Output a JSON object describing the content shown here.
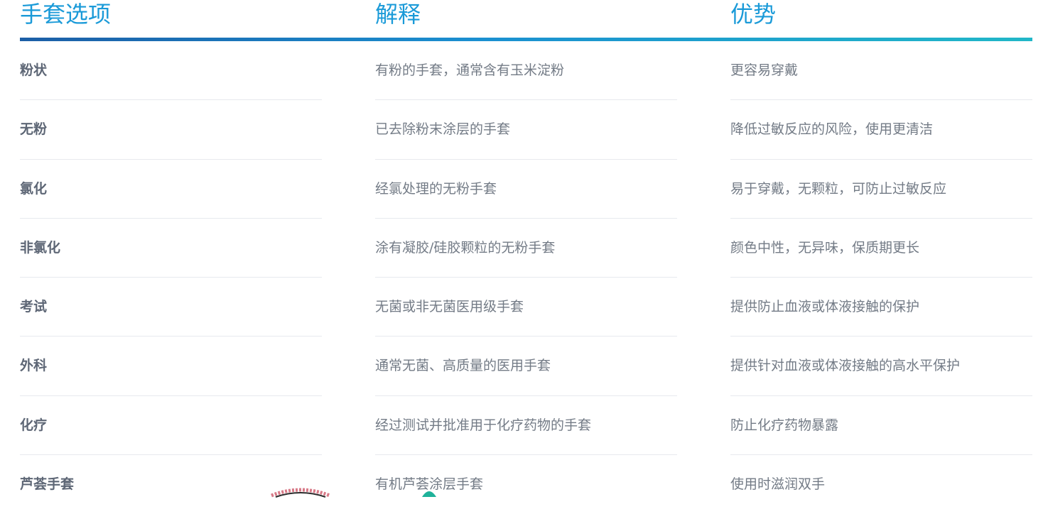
{
  "table": {
    "headers": [
      "手套选项",
      "解释",
      "优势"
    ],
    "rows": [
      {
        "option": "粉状",
        "explanation": "有粉的手套，通常含有玉米淀粉",
        "advantage": "更容易穿戴"
      },
      {
        "option": "无粉",
        "explanation": "已去除粉末涂层的手套",
        "advantage": "降低过敏反应的风险，使用更清洁"
      },
      {
        "option": "氯化",
        "explanation": "经氯处理的无粉手套",
        "advantage": "易于穿戴，无颗粒，可防止过敏反应"
      },
      {
        "option": "非氯化",
        "explanation": "涂有凝胶/硅胶颗粒的无粉手套",
        "advantage": "颜色中性，无异味，保质期更长"
      },
      {
        "option": "考试",
        "explanation": "无菌或非无菌医用级手套",
        "advantage": "提供防止血液或体液接触的保护"
      },
      {
        "option": "外科",
        "explanation": "通常无菌、高质量的医用手套",
        "advantage": "提供针对血液或体液接触的高水平保护"
      },
      {
        "option": "化疗",
        "explanation": "经过测试并批准用于化疗药物的手套",
        "advantage": "防止化疗药物暴露"
      },
      {
        "option": "芦荟手套",
        "explanation": "有机芦荟涂层手套",
        "advantage": "使用时滋润双手"
      }
    ]
  },
  "colors": {
    "header_text": "#1a9ad8",
    "rule_start": "#1b5ea6",
    "rule_end": "#21b7c8",
    "option_text": "#5d6675",
    "body_text": "#737b86",
    "divider": "#e7e9ee"
  },
  "icons": {
    "partial_logo": "badge-icon",
    "partial_mark": "leaf-icon"
  }
}
